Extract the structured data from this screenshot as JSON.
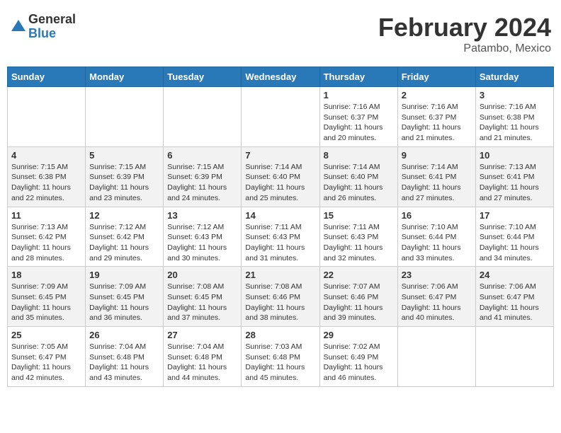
{
  "header": {
    "logo_general": "General",
    "logo_blue": "Blue",
    "month_title": "February 2024",
    "location": "Patambo, Mexico"
  },
  "days_of_week": [
    "Sunday",
    "Monday",
    "Tuesday",
    "Wednesday",
    "Thursday",
    "Friday",
    "Saturday"
  ],
  "weeks": [
    [
      {
        "day": "",
        "info": ""
      },
      {
        "day": "",
        "info": ""
      },
      {
        "day": "",
        "info": ""
      },
      {
        "day": "",
        "info": ""
      },
      {
        "day": "1",
        "info": "Sunrise: 7:16 AM\nSunset: 6:37 PM\nDaylight: 11 hours\nand 20 minutes."
      },
      {
        "day": "2",
        "info": "Sunrise: 7:16 AM\nSunset: 6:37 PM\nDaylight: 11 hours\nand 21 minutes."
      },
      {
        "day": "3",
        "info": "Sunrise: 7:16 AM\nSunset: 6:38 PM\nDaylight: 11 hours\nand 21 minutes."
      }
    ],
    [
      {
        "day": "4",
        "info": "Sunrise: 7:15 AM\nSunset: 6:38 PM\nDaylight: 11 hours\nand 22 minutes."
      },
      {
        "day": "5",
        "info": "Sunrise: 7:15 AM\nSunset: 6:39 PM\nDaylight: 11 hours\nand 23 minutes."
      },
      {
        "day": "6",
        "info": "Sunrise: 7:15 AM\nSunset: 6:39 PM\nDaylight: 11 hours\nand 24 minutes."
      },
      {
        "day": "7",
        "info": "Sunrise: 7:14 AM\nSunset: 6:40 PM\nDaylight: 11 hours\nand 25 minutes."
      },
      {
        "day": "8",
        "info": "Sunrise: 7:14 AM\nSunset: 6:40 PM\nDaylight: 11 hours\nand 26 minutes."
      },
      {
        "day": "9",
        "info": "Sunrise: 7:14 AM\nSunset: 6:41 PM\nDaylight: 11 hours\nand 27 minutes."
      },
      {
        "day": "10",
        "info": "Sunrise: 7:13 AM\nSunset: 6:41 PM\nDaylight: 11 hours\nand 27 minutes."
      }
    ],
    [
      {
        "day": "11",
        "info": "Sunrise: 7:13 AM\nSunset: 6:42 PM\nDaylight: 11 hours\nand 28 minutes."
      },
      {
        "day": "12",
        "info": "Sunrise: 7:12 AM\nSunset: 6:42 PM\nDaylight: 11 hours\nand 29 minutes."
      },
      {
        "day": "13",
        "info": "Sunrise: 7:12 AM\nSunset: 6:43 PM\nDaylight: 11 hours\nand 30 minutes."
      },
      {
        "day": "14",
        "info": "Sunrise: 7:11 AM\nSunset: 6:43 PM\nDaylight: 11 hours\nand 31 minutes."
      },
      {
        "day": "15",
        "info": "Sunrise: 7:11 AM\nSunset: 6:43 PM\nDaylight: 11 hours\nand 32 minutes."
      },
      {
        "day": "16",
        "info": "Sunrise: 7:10 AM\nSunset: 6:44 PM\nDaylight: 11 hours\nand 33 minutes."
      },
      {
        "day": "17",
        "info": "Sunrise: 7:10 AM\nSunset: 6:44 PM\nDaylight: 11 hours\nand 34 minutes."
      }
    ],
    [
      {
        "day": "18",
        "info": "Sunrise: 7:09 AM\nSunset: 6:45 PM\nDaylight: 11 hours\nand 35 minutes."
      },
      {
        "day": "19",
        "info": "Sunrise: 7:09 AM\nSunset: 6:45 PM\nDaylight: 11 hours\nand 36 minutes."
      },
      {
        "day": "20",
        "info": "Sunrise: 7:08 AM\nSunset: 6:45 PM\nDaylight: 11 hours\nand 37 minutes."
      },
      {
        "day": "21",
        "info": "Sunrise: 7:08 AM\nSunset: 6:46 PM\nDaylight: 11 hours\nand 38 minutes."
      },
      {
        "day": "22",
        "info": "Sunrise: 7:07 AM\nSunset: 6:46 PM\nDaylight: 11 hours\nand 39 minutes."
      },
      {
        "day": "23",
        "info": "Sunrise: 7:06 AM\nSunset: 6:47 PM\nDaylight: 11 hours\nand 40 minutes."
      },
      {
        "day": "24",
        "info": "Sunrise: 7:06 AM\nSunset: 6:47 PM\nDaylight: 11 hours\nand 41 minutes."
      }
    ],
    [
      {
        "day": "25",
        "info": "Sunrise: 7:05 AM\nSunset: 6:47 PM\nDaylight: 11 hours\nand 42 minutes."
      },
      {
        "day": "26",
        "info": "Sunrise: 7:04 AM\nSunset: 6:48 PM\nDaylight: 11 hours\nand 43 minutes."
      },
      {
        "day": "27",
        "info": "Sunrise: 7:04 AM\nSunset: 6:48 PM\nDaylight: 11 hours\nand 44 minutes."
      },
      {
        "day": "28",
        "info": "Sunrise: 7:03 AM\nSunset: 6:48 PM\nDaylight: 11 hours\nand 45 minutes."
      },
      {
        "day": "29",
        "info": "Sunrise: 7:02 AM\nSunset: 6:49 PM\nDaylight: 11 hours\nand 46 minutes."
      },
      {
        "day": "",
        "info": ""
      },
      {
        "day": "",
        "info": ""
      }
    ]
  ]
}
